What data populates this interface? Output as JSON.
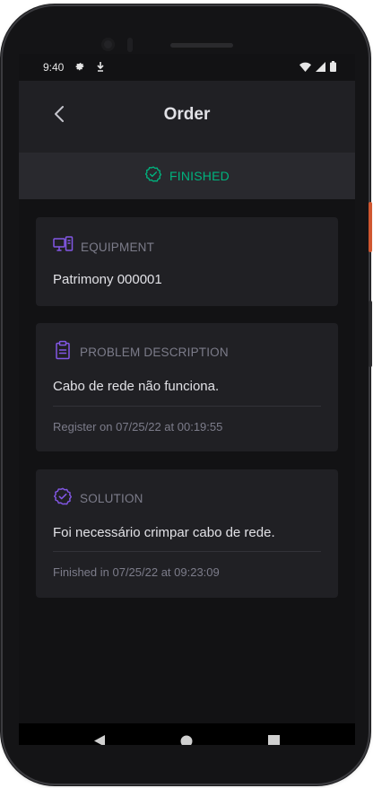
{
  "statusbar": {
    "time": "9:40"
  },
  "header": {
    "title": "Order"
  },
  "status": {
    "label": "FINISHED",
    "color": "#00b37e"
  },
  "cards": {
    "equipment": {
      "title": "EQUIPMENT",
      "value": "Patrimony 000001"
    },
    "problem": {
      "title": "PROBLEM DESCRIPTION",
      "value": "Cabo de rede não funciona.",
      "footer": "Register on 07/25/22 at 00:19:55"
    },
    "solution": {
      "title": "SOLUTION",
      "value": "Foi necessário crimpar cabo de rede.",
      "footer": "Finished in 07/25/22 at 09:23:09"
    }
  },
  "icons": {
    "back": "chevron-left-icon",
    "status": "circle-wavy-check-icon",
    "equipment": "desktop-tower-icon",
    "problem": "clipboard-text-icon",
    "solution": "circle-wavy-check-icon"
  },
  "colors": {
    "accent": "#8257e5",
    "success": "#00b37e",
    "background": "#121214",
    "surface": "#202024"
  }
}
